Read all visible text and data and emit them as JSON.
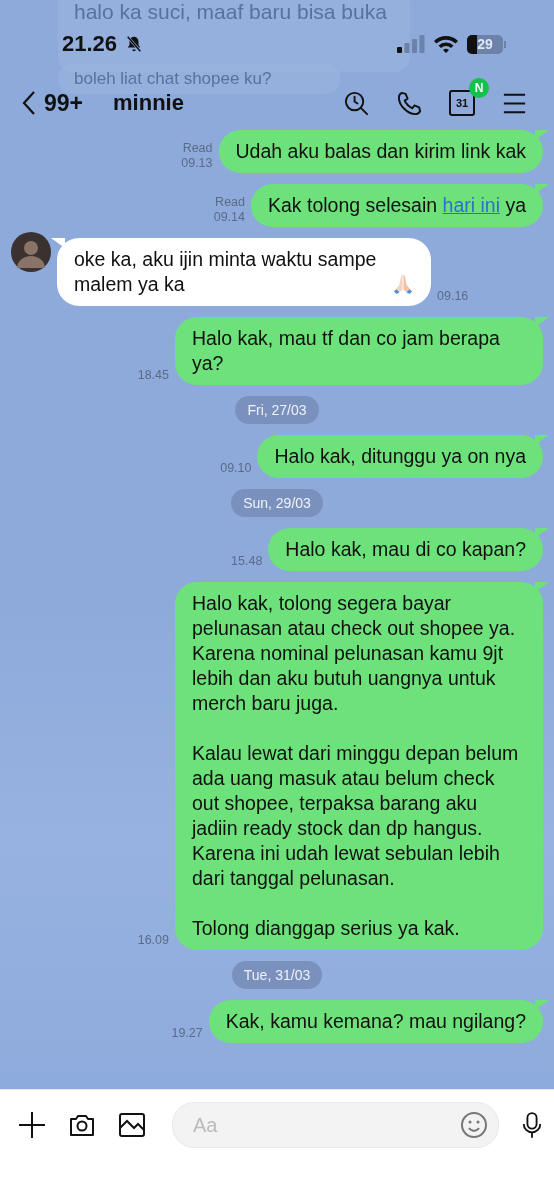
{
  "notifications": [
    {
      "text": "halo ka suci, maaf baru bisa buka"
    },
    {
      "text": "boleh liat chat shopee ku?"
    }
  ],
  "status_bar": {
    "time": "21.26",
    "battery": "29"
  },
  "header": {
    "unread": "99+",
    "name": "minnie",
    "calendar_day": "31",
    "calendar_badge": "N"
  },
  "messages": [
    {
      "kind": "sent",
      "read": true,
      "read_label": "Read",
      "time": "09.13",
      "segments": [
        {
          "kind": "plain",
          "text": "Udah aku balas dan kirim link kak"
        }
      ]
    },
    {
      "kind": "sent",
      "read": true,
      "read_label": "Read",
      "time": "09.14",
      "segments": [
        {
          "kind": "plain",
          "text": "Kak tolong selesain "
        },
        {
          "kind": "link",
          "text": "hari ini"
        },
        {
          "kind": "plain",
          "text": " ya"
        }
      ]
    },
    {
      "kind": "received",
      "time": "09.16",
      "segments": [
        {
          "kind": "plain",
          "text": "oke ka, aku ijin minta waktu sampe malem ya ka"
        },
        {
          "kind": "praying-hands"
        }
      ]
    },
    {
      "kind": "sent",
      "read": false,
      "time": "18.45",
      "segments": [
        {
          "kind": "plain",
          "text": "Halo kak, mau tf dan co jam berapa ya?"
        }
      ]
    },
    {
      "kind": "date",
      "text": "Fri, 27/03"
    },
    {
      "kind": "sent",
      "read": false,
      "time": "09.10",
      "segments": [
        {
          "kind": "plain",
          "text": "Halo kak, ditunggu ya on nya"
        }
      ]
    },
    {
      "kind": "date",
      "text": "Sun, 29/03"
    },
    {
      "kind": "sent",
      "read": false,
      "time": "15.48",
      "segments": [
        {
          "kind": "plain",
          "text": "Halo kak, mau di co kapan?"
        }
      ]
    },
    {
      "kind": "sent",
      "read": false,
      "time": "16.09",
      "segments": [
        {
          "kind": "plain",
          "text": "Halo kak, tolong segera bayar pelunasan atau check out shopee ya. Karena nominal pelunasan kamu 9jt lebih dan aku butuh uangnya untuk merch baru juga.\n\nKalau lewat dari minggu depan belum ada uang masuk atau belum check out shopee, terpaksa barang aku jadiin ready stock dan dp hangus. Karena ini udah lewat sebulan lebih dari tanggal pelunasan.\n\nTolong dianggap serius ya kak."
        }
      ]
    },
    {
      "kind": "date",
      "text": "Tue, 31/03"
    },
    {
      "kind": "sent",
      "read": false,
      "time": "19.27",
      "segments": [
        {
          "kind": "plain",
          "text": "Kak, kamu kemana? mau ngilang?"
        }
      ]
    }
  ],
  "composer": {
    "placeholder": "Aa"
  }
}
